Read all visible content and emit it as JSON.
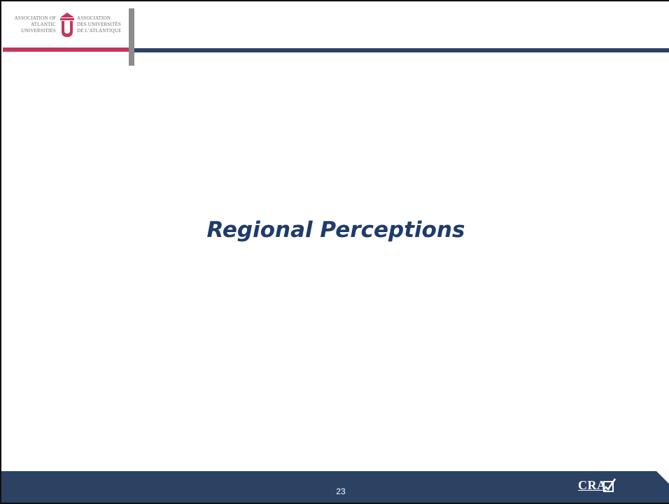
{
  "header": {
    "logo_left_text": "ASSOCIATION OF\nATLANTIC\nUNIVERSITIES",
    "logo_right_text": "ASSOCIATION\nDES UNIVERSITÉS\nDE L'ATLANTIQUE",
    "logo_icon": "university-shield-icon"
  },
  "main": {
    "title": "Regional Perceptions"
  },
  "footer": {
    "page_number": "23",
    "brand_text": "CRA",
    "brand_icon": "checkmark-ballot-icon"
  },
  "colors": {
    "navy": "#2b4263",
    "accent_pink": "#c4365b",
    "title_blue": "#1f3b6b",
    "divider_gray": "#8c8c8c"
  }
}
